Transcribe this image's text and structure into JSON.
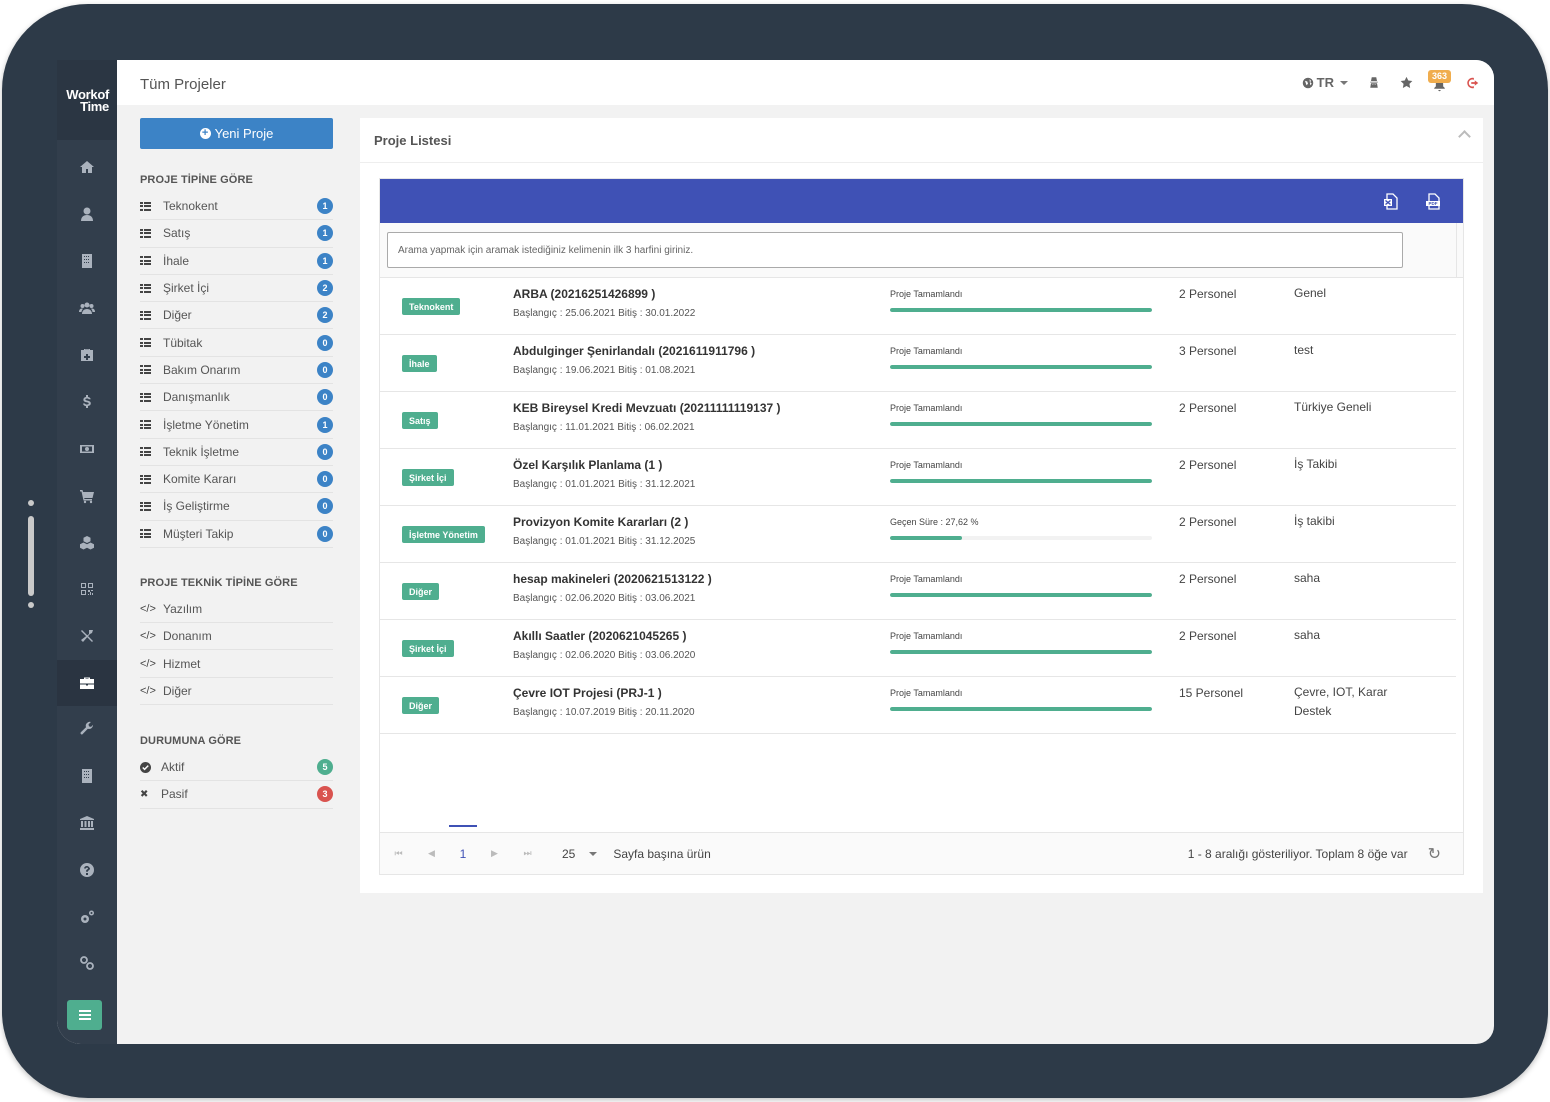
{
  "app": {
    "logo_line1": "Work",
    "logo_of": "of",
    "logo_line2": "Time",
    "page_title": "Tüm Projeler"
  },
  "topbar": {
    "language": "TR",
    "notification_count": "363"
  },
  "left_nav": [
    {
      "icon": "home-icon"
    },
    {
      "icon": "user-icon"
    },
    {
      "icon": "building-icon"
    },
    {
      "icon": "users-icon"
    },
    {
      "icon": "medkit-icon"
    },
    {
      "icon": "dollar-icon"
    },
    {
      "icon": "money-icon"
    },
    {
      "icon": "cart-icon"
    },
    {
      "icon": "cubes-icon"
    },
    {
      "icon": "qrcode-icon"
    },
    {
      "icon": "tools-icon"
    },
    {
      "icon": "briefcase-icon",
      "active": true
    },
    {
      "icon": "wrench-icon"
    },
    {
      "icon": "building-icon"
    },
    {
      "icon": "bank-icon"
    },
    {
      "icon": "question-icon"
    },
    {
      "icon": "cogs-icon"
    },
    {
      "icon": "link-icon"
    }
  ],
  "filters": {
    "new_button": "Yeni Proje",
    "by_type_title": "PROJE TİPİNE GÖRE",
    "by_type": [
      {
        "label": "Teknokent",
        "count": "1"
      },
      {
        "label": "Satış",
        "count": "1"
      },
      {
        "label": "İhale",
        "count": "1"
      },
      {
        "label": "Şirket İçi",
        "count": "2"
      },
      {
        "label": "Diğer",
        "count": "2"
      },
      {
        "label": "Tübitak",
        "count": "0"
      },
      {
        "label": "Bakım Onarım",
        "count": "0"
      },
      {
        "label": "Danışmanlık",
        "count": "0"
      },
      {
        "label": "İşletme Yönetim",
        "count": "1"
      },
      {
        "label": "Teknik İşletme",
        "count": "0"
      },
      {
        "label": "Komite Kararı",
        "count": "0"
      },
      {
        "label": "İş Geliştirme",
        "count": "0"
      },
      {
        "label": "Müşteri Takip",
        "count": "0"
      }
    ],
    "by_tech_title": "PROJE TEKNİK TİPİNE GÖRE",
    "by_tech": [
      {
        "label": "Yazılım"
      },
      {
        "label": "Donanım"
      },
      {
        "label": "Hizmet"
      },
      {
        "label": "Diğer"
      }
    ],
    "by_status_title": "DURUMUNA GÖRE",
    "by_status": [
      {
        "label": "Aktif",
        "count": "5",
        "color": "#4fae8f"
      },
      {
        "label": "Pasif",
        "count": "3",
        "color": "#d9534f"
      }
    ]
  },
  "panel": {
    "title": "Proje Listesi",
    "search_placeholder": "Arama yapmak için aramak istediğiniz kelimenin ilk 3 harfini giriniz.",
    "projects": [
      {
        "tag": "Teknokent",
        "name": "ARBA (20216251426899 )",
        "dates": "Başlangıç : 25.06.2021 Bitiş : 30.01.2022",
        "status": "Proje Tamamlandı",
        "progress": 100,
        "staff": "2 Personel",
        "desc": "Genel"
      },
      {
        "tag": "İhale",
        "name": "Abdulginger Şenirlandalı (2021611911796 )",
        "dates": "Başlangıç : 19.06.2021 Bitiş : 01.08.2021",
        "status": "Proje Tamamlandı",
        "progress": 100,
        "staff": "3 Personel",
        "desc": "test"
      },
      {
        "tag": "Satış",
        "name": "KEB Bireysel Kredi Mevzuatı (20211111119137 )",
        "dates": "Başlangıç : 11.01.2021 Bitiş : 06.02.2021",
        "status": "Proje Tamamlandı",
        "progress": 100,
        "staff": "2 Personel",
        "desc": "Türkiye Geneli"
      },
      {
        "tag": "Şirket İçi",
        "name": "Özel Karşılık Planlama (1 )",
        "dates": "Başlangıç : 01.01.2021 Bitiş : 31.12.2021",
        "status": "Proje Tamamlandı",
        "progress": 100,
        "staff": "2 Personel",
        "desc": "İş Takibi"
      },
      {
        "tag": "İşletme Yönetim",
        "name": "Provizyon Komite Kararları (2 )",
        "dates": "Başlangıç : 01.01.2021 Bitiş : 31.12.2025",
        "status": "Geçen Süre : 27,62 %",
        "progress": 27.62,
        "staff": "2 Personel",
        "desc": "İş takibi"
      },
      {
        "tag": "Diğer",
        "name": "hesap makineleri (2020621513122 )",
        "dates": "Başlangıç : 02.06.2020 Bitiş : 03.06.2021",
        "status": "Proje Tamamlandı",
        "progress": 100,
        "staff": "2 Personel",
        "desc": "saha"
      },
      {
        "tag": "Şirket İçi",
        "name": "Akıllı Saatler (2020621045265 )",
        "dates": "Başlangıç : 02.06.2020 Bitiş : 03.06.2020",
        "status": "Proje Tamamlandı",
        "progress": 100,
        "staff": "2 Personel",
        "desc": "saha"
      },
      {
        "tag": "Diğer",
        "name": "Çevre IOT Projesi (PRJ-1 )",
        "dates": "Başlangıç : 10.07.2019 Bitiş : 20.11.2020",
        "status": "Proje Tamamlandı",
        "progress": 100,
        "staff": "15 Personel",
        "desc": "Çevre, IOT, Karar Destek"
      }
    ],
    "pager": {
      "current_page": "1",
      "page_size": "25",
      "page_size_label": "Sayfa başına ürün",
      "info": "1 - 8 aralığı gösteriliyor. Toplam 8 öğe var"
    }
  }
}
